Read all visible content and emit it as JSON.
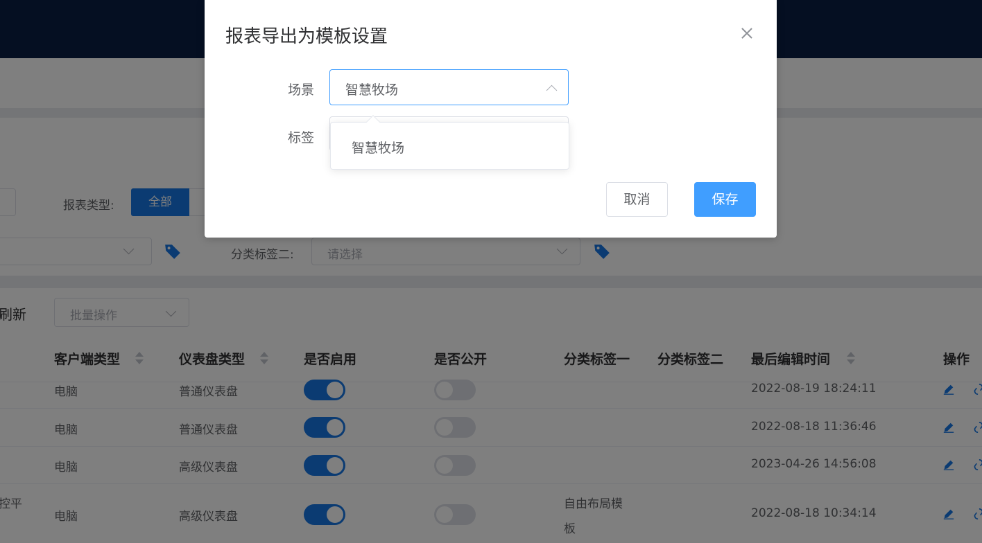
{
  "background": {
    "filters": {
      "report_type_label": "报表类型:",
      "report_type_all": "全部",
      "category_tag_two_label": "分类标签二:",
      "category_tag_two_placeholder": "请选择"
    },
    "toolbar": {
      "refresh_label": "刷新",
      "batch_placeholder": "批量操作"
    },
    "table": {
      "headers": {
        "client_type": "客户端类型",
        "dashboard_type": "仪表盘类型",
        "enabled": "是否启用",
        "public": "是否公开",
        "tag_one": "分类标签一",
        "tag_two": "分类标签二",
        "last_edit": "最后编辑时间",
        "actions": "操作"
      },
      "rows": [
        {
          "name": "",
          "client": "电脑",
          "dashboard": "普通仪表盘",
          "enabled": true,
          "public": false,
          "tag1": "",
          "tag1b": "",
          "time": "2022-08-19 18:24:11"
        },
        {
          "name": "",
          "client": "电脑",
          "dashboard": "普通仪表盘",
          "enabled": true,
          "public": false,
          "tag1": "",
          "tag1b": "",
          "time": "2022-08-18 11:36:46"
        },
        {
          "name": "",
          "client": "电脑",
          "dashboard": "高级仪表盘",
          "enabled": true,
          "public": false,
          "tag1": "",
          "tag1b": "",
          "time": "2023-04-26 14:56:08"
        },
        {
          "name": "控平",
          "client": "电脑",
          "dashboard": "高级仪表盘",
          "enabled": true,
          "public": false,
          "tag1": "自由布局模",
          "tag1b": "板",
          "time": "2022-08-18 10:34:14"
        }
      ]
    }
  },
  "dialog": {
    "title": "报表导出为模板设置",
    "scene_label": "场景",
    "scene_value": "智慧牧场",
    "tag_label": "标签",
    "cancel_label": "取消",
    "save_label": "保存"
  },
  "dropdown": {
    "options": [
      "智慧牧场"
    ]
  },
  "colors": {
    "primary": "#409eff",
    "switch_on": "#1677e5",
    "header_bg": "#0a1f44"
  },
  "icons": [
    "tag-icon",
    "chevron-down-icon",
    "chevron-up-icon",
    "close-icon",
    "sort-icon",
    "pencil-icon",
    "link-icon"
  ]
}
